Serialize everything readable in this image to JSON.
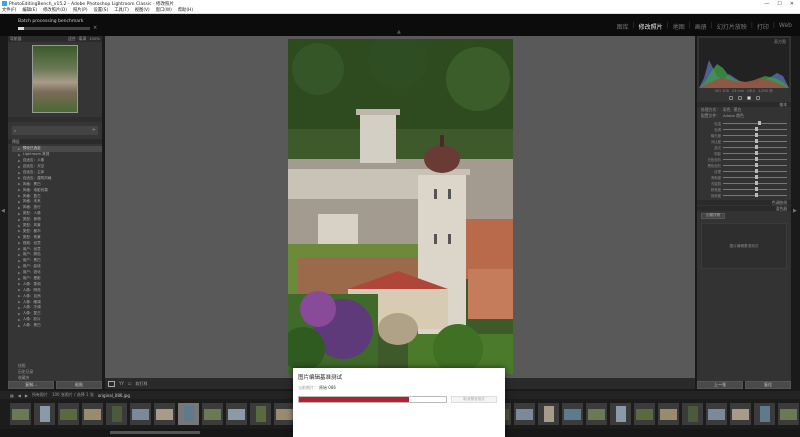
{
  "window": {
    "title": "PhotoEditingBench_v15.2 - Adobe Photoshop Lightroom Classic - 修改照片",
    "controls": [
      "—",
      "☐",
      "✕"
    ]
  },
  "menu": [
    "文件(F)",
    "编辑(E)",
    "修改照片(D)",
    "照片(P)",
    "设置(S)",
    "工具(T)",
    "视图(V)",
    "窗口(W)",
    "帮助(H)"
  ],
  "task": {
    "label": "Batch processing benchmark",
    "progress": 0.08,
    "close": "×"
  },
  "modules": [
    {
      "label": "图库",
      "active": false
    },
    {
      "label": "修改照片",
      "active": true
    },
    {
      "label": "地图",
      "active": false
    },
    {
      "label": "画册",
      "active": false
    },
    {
      "label": "幻灯片放映",
      "active": false
    },
    {
      "label": "打印",
      "active": false
    },
    {
      "label": "Web",
      "active": false
    }
  ],
  "left_panel": {
    "navigator_label": "导航器",
    "navigator_zoom": [
      "适合",
      "填满",
      "100%"
    ],
    "presets_header": "预设",
    "presets": [
      {
        "label": "预设已选定",
        "selected": true
      },
      {
        "label": "Lightroom 常规",
        "selected": false
      },
      {
        "label": "自适应：人像",
        "selected": false
      },
      {
        "label": "自适应：天空",
        "selected": false
      },
      {
        "label": "自适应：主体",
        "selected": false
      },
      {
        "label": "自适应：建筑风格",
        "selected": false
      },
      {
        "label": "风格：黑白",
        "selected": false
      },
      {
        "label": "风格：电影效果",
        "selected": false
      },
      {
        "label": "风格：复古",
        "selected": false
      },
      {
        "label": "风格：未来",
        "selected": false
      },
      {
        "label": "风格：旅行",
        "selected": false
      },
      {
        "label": "类型：人像",
        "selected": false
      },
      {
        "label": "类型：食物",
        "selected": false
      },
      {
        "label": "类型：风景",
        "selected": false
      },
      {
        "label": "类型：都市",
        "selected": false
      },
      {
        "label": "类型：夜景",
        "selected": false
      },
      {
        "label": "视频：创意",
        "selected": false
      },
      {
        "label": "用户：创意",
        "selected": false
      },
      {
        "label": "用户：颜色",
        "selected": false
      },
      {
        "label": "用户：黑白",
        "selected": false
      },
      {
        "label": "用户：曲线",
        "selected": false
      },
      {
        "label": "用户：锐化",
        "selected": false
      },
      {
        "label": "用户：晕影",
        "selected": false
      },
      {
        "label": "人像：柔和",
        "selected": false
      },
      {
        "label": "人像：明亮",
        "selected": false
      },
      {
        "label": "人像：自然",
        "selected": false
      },
      {
        "label": "人像：暖调",
        "selected": false
      },
      {
        "label": "人像：冷调",
        "selected": false
      },
      {
        "label": "人像：复古",
        "selected": false
      },
      {
        "label": "人像：胶片",
        "selected": false
      },
      {
        "label": "人像：黑白",
        "selected": false
      }
    ],
    "extras": [
      "快照",
      "历史记录",
      "收藏夹"
    ],
    "copy_button": "复制...",
    "paste_button": "粘贴"
  },
  "toolbar": {
    "view_label": "YY",
    "softproof_label": "软打样"
  },
  "right_panel": {
    "histogram_label": "直方图",
    "histogram_info": [
      "ISO 100",
      "24 mm",
      "f/8.0",
      "1/250 秒"
    ],
    "basic_header": "基本",
    "treatment_label": "处理方式：",
    "treatment_options": [
      "彩色",
      "黑白"
    ],
    "profile_label": "配置文件：",
    "profile_value": "Adobe 颜色",
    "sliders": [
      {
        "label": "色温",
        "value": 0.55
      },
      {
        "label": "色调",
        "value": 0.5
      },
      {
        "label": "曝光度",
        "value": 0.5
      },
      {
        "label": "对比度",
        "value": 0.5
      },
      {
        "label": "高光",
        "value": 0.5
      },
      {
        "label": "阴影",
        "value": 0.5
      },
      {
        "label": "白色色阶",
        "value": 0.5
      },
      {
        "label": "黑色色阶",
        "value": 0.5
      },
      {
        "label": "纹理",
        "value": 0.5
      },
      {
        "label": "清晰度",
        "value": 0.5
      },
      {
        "label": "去朦胧",
        "value": 0.5
      },
      {
        "label": "鲜艳度",
        "value": 0.5
      },
      {
        "label": "饱和度",
        "value": 0.5
      }
    ],
    "tone_curve": "色调曲线",
    "color_mixer": "混色器",
    "snapshot_button": "创建快照",
    "description": "图片编辑基准测试",
    "prev_button": "上一张",
    "reset_button": "复位"
  },
  "filmstrip": {
    "info": "所有照片",
    "count": "100 张照片 / 选择 1 张",
    "filename": "original_086.jpg"
  },
  "dialog": {
    "title": "图片编辑基准测试",
    "label": "当前图片：",
    "name": "原始 086",
    "progress": 0.75,
    "cancel": "取消基准测试"
  }
}
